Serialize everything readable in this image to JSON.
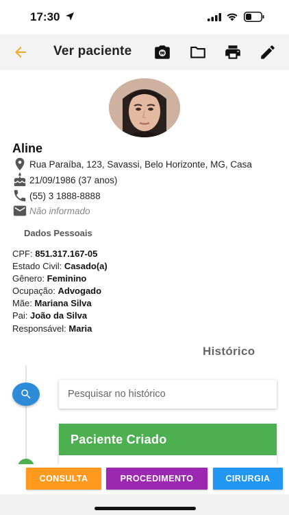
{
  "status_bar": {
    "time": "17:30",
    "icons": [
      "location-arrow-icon",
      "cellular-signal-icon",
      "wifi-icon",
      "battery-icon"
    ]
  },
  "app_bar": {
    "title": "Ver paciente",
    "back_icon": "arrow-back-icon",
    "actions": [
      "camera-icon",
      "folder-icon",
      "print-icon",
      "edit-icon"
    ],
    "accent_color": "#f5a623"
  },
  "patient": {
    "name": "Aline",
    "address": "Rua Paraíba, 123, Savassi, Belo Horizonte, MG, Casa",
    "birth": "21/09/1986 (37 anos)",
    "phone": "(55) 3 1888-8888",
    "email": "Não informado"
  },
  "personal": {
    "section_title": "Dados Pessoais",
    "fields": [
      {
        "label": "CPF: ",
        "value": "851.317.167-05"
      },
      {
        "label": "Estado Civil: ",
        "value": "Casado(a)"
      },
      {
        "label": "Gênero: ",
        "value": "Feminino"
      },
      {
        "label": "Ocupação: ",
        "value": "Advogado"
      },
      {
        "label": "Mãe: ",
        "value": "Mariana Silva"
      },
      {
        "label": "Pai: ",
        "value": "João da Silva"
      },
      {
        "label": "Responsável: ",
        "value": "Maria"
      }
    ]
  },
  "history": {
    "title": "Histórico",
    "search_placeholder": "Pesquisar no histórico",
    "events": [
      {
        "label": "Paciente Criado",
        "color": "#4caf50"
      }
    ]
  },
  "actions": {
    "consulta": {
      "label": "CONSULTA",
      "color": "#ff9a1f"
    },
    "procedimento": {
      "label": "PROCEDIMENTO",
      "color": "#9c27b0"
    },
    "cirurgia": {
      "label": "CIRURGIA",
      "color": "#2196f3"
    }
  }
}
